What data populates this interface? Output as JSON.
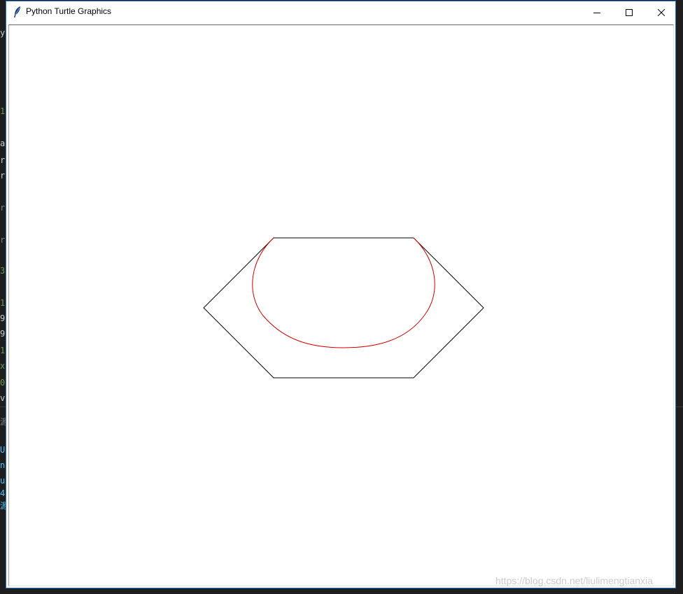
{
  "window": {
    "title": "Python Turtle Graphics",
    "icon": "feather-icon",
    "controls": {
      "minimize_icon": "minimize-icon",
      "maximize_icon": "maximize-icon",
      "close_icon": "close-icon"
    }
  },
  "background_editor": {
    "visible_glyphs": [
      "y",
      "1",
      "a",
      "r",
      "r",
      "r",
      "r",
      "3",
      "1",
      "9",
      "9",
      "1",
      "x",
      "0",
      "v",
      "源",
      "U",
      "n",
      "u",
      "4",
      "源"
    ]
  },
  "drawing": {
    "hexagon_color": "#000000",
    "ellipse_color": "#d40000"
  },
  "watermark": {
    "text": "https://blog.csdn.net/liulimengtianxia"
  }
}
